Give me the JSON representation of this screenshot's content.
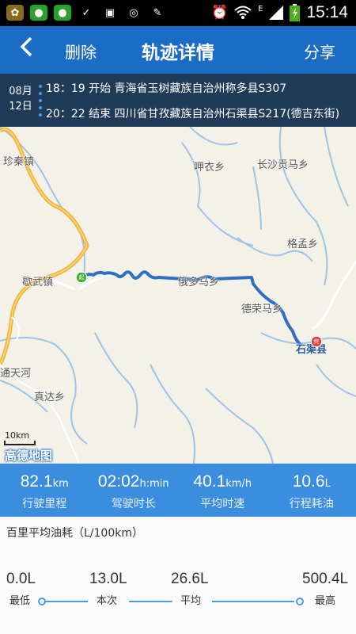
{
  "status_bar": {
    "time": "15:14",
    "network": "E",
    "left_icons": [
      "flower-app-icon",
      "wechat-icon",
      "wechat-icon",
      "download-done-icon",
      "screenshot-icon",
      "browser-icon",
      "pen-icon"
    ],
    "right_icons": [
      "alarm-icon",
      "wifi-icon",
      "signal-icon",
      "battery-charging-icon"
    ]
  },
  "header": {
    "back_label": "<",
    "delete_label": "删除",
    "title": "轨迹详情",
    "share_label": "分享"
  },
  "trip": {
    "date_month": "08月",
    "date_day": "12日",
    "start": "18：19 开始 青海省玉树藏族自治州称多县S307",
    "end": "20：22 结束 四川省甘孜藏族自治州石渠县S217(德吉东街)"
  },
  "map": {
    "places": {
      "zhenqin": "珍秦镇",
      "huyi": "呷衣乡",
      "changsha": "长沙贡马乡",
      "gemeng": "格孟乡",
      "xiewu": "歇武镇",
      "eduoma": "俄多马乡",
      "derongma": "德荣马乡",
      "shiqu": "石渠县",
      "tongtianhe": "通天河",
      "zhenda": "真达乡"
    },
    "start_marker": "起",
    "end_marker": "终",
    "scale": "10km",
    "logo": "高德地图"
  },
  "stats": [
    {
      "value": "82.1",
      "unit": "km",
      "label": "行驶里程"
    },
    {
      "value": "02:02",
      "unit": "h:min",
      "label": "驾驶时长"
    },
    {
      "value": "40.1",
      "unit": "km/h",
      "label": "平均时速"
    },
    {
      "value": "10.6",
      "unit": "L",
      "label": "行程耗油"
    }
  ],
  "fuel": {
    "title": "百里平均油耗（L/100km）",
    "items": [
      {
        "value": "0.0L",
        "label": "最低"
      },
      {
        "value": "13.0L",
        "label": "本次"
      },
      {
        "value": "26.6L",
        "label": "平均"
      },
      {
        "value": "500.4L",
        "label": "最高"
      }
    ]
  },
  "colors": {
    "header": "#1a6cc5",
    "trip_bar": "#1f3b58",
    "stats": "#3b8de0",
    "route": "#2f6fbf"
  }
}
